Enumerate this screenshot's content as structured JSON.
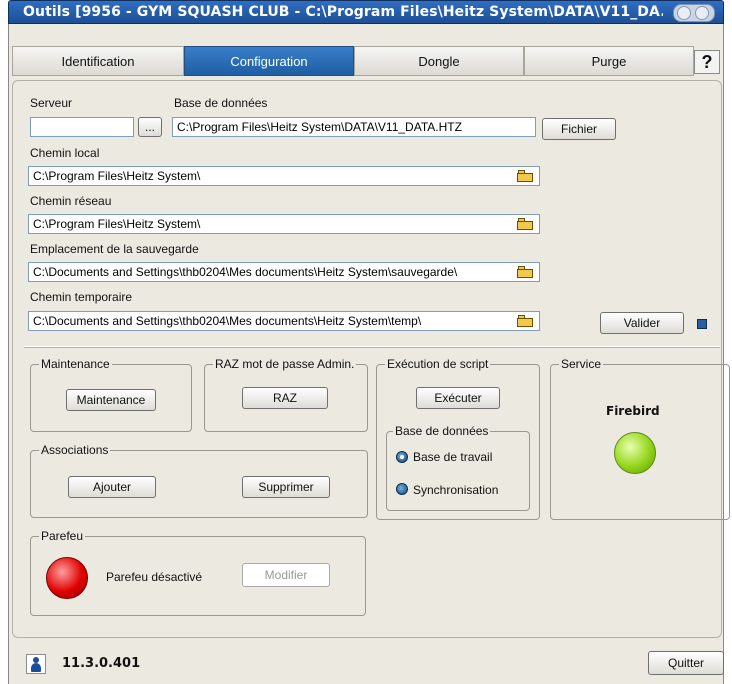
{
  "window": {
    "title": "Outils [9956 - GYM SQUASH CLUB - C:\\Program Files\\Heitz System\\DATA\\V11_DA..."
  },
  "tabs": [
    {
      "label": "Identification",
      "active": false
    },
    {
      "label": "Configuration",
      "active": true
    },
    {
      "label": "Dongle",
      "active": false
    },
    {
      "label": "Purge",
      "active": false
    }
  ],
  "help_label": "?",
  "config": {
    "serveur_label": "Serveur",
    "serveur_value": "",
    "browse_label": "...",
    "db_label": "Base de données",
    "db_value": "C:\\Program Files\\Heitz System\\DATA\\V11_DATA.HTZ",
    "fichier_label": "Fichier",
    "chemin_local_label": "Chemin local",
    "chemin_local_value": "C:\\Program Files\\Heitz System\\",
    "chemin_reseau_label": "Chemin réseau",
    "chemin_reseau_value": "C:\\Program Files\\Heitz System\\",
    "sauvegarde_label": "Emplacement de la sauvegarde",
    "sauvegarde_value": "C:\\Documents and Settings\\thb0204\\Mes documents\\Heitz System\\sauvegarde\\",
    "temp_label": "Chemin temporaire",
    "temp_value": "C:\\Documents and Settings\\thb0204\\Mes documents\\Heitz System\\temp\\",
    "valider_label": "Valider"
  },
  "maintenance": {
    "title": "Maintenance",
    "button": "Maintenance"
  },
  "raz": {
    "title": "RAZ mot de passe Admin.",
    "button": "RAZ"
  },
  "script": {
    "title": "Exécution de script",
    "button": "Exécuter",
    "db_group_title": "Base de données",
    "option_travail": "Base de travail",
    "option_sync": "Synchronisation",
    "selected": "Base de travail"
  },
  "service": {
    "title": "Service",
    "name": "Firebird",
    "status_color": "#93d51a"
  },
  "associations": {
    "title": "Associations",
    "add": "Ajouter",
    "delete": "Supprimer"
  },
  "parefeu": {
    "title": "Parefeu",
    "status": "Parefeu désactivé",
    "modify": "Modifier",
    "status_color": "#e00000"
  },
  "footer": {
    "version": "11.3.0.401",
    "quit": "Quitter"
  },
  "colors": {
    "accent": "#1f5ea4",
    "panel": "#ece9e1"
  }
}
